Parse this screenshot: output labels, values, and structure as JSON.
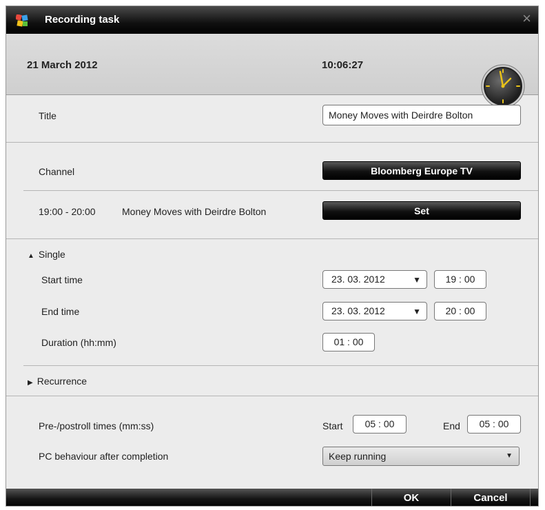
{
  "window": {
    "title": "Recording task",
    "close_glyph": "×"
  },
  "header": {
    "date": "21 March 2012",
    "time": "10:06:27",
    "clock_icon": "analog-clock-icon"
  },
  "form": {
    "title_label": "Title",
    "title_value": "Money Moves with Deirdre Bolton",
    "channel_label": "Channel",
    "channel_value": "Bloomberg Europe TV",
    "program_time": "19:00 - 20:00",
    "program_name": "Money Moves with Deirdre Bolton",
    "set_label": "Set"
  },
  "single": {
    "expander_label": "Single",
    "expanded": true,
    "start_label": "Start time",
    "start_date": "23. 03. 2012",
    "start_time": "19 : 00",
    "end_label": "End time",
    "end_date": "23. 03. 2012",
    "end_time": "20 : 00",
    "duration_label": "Duration (hh:mm)",
    "duration_value": "01 : 00"
  },
  "recurrence": {
    "expander_label": "Recurrence",
    "expanded": false
  },
  "options": {
    "preroll_label": "Pre-/postroll times (mm:ss)",
    "start_label": "Start",
    "start_value": "05 : 00",
    "end_label": "End",
    "end_value": "05 : 00",
    "pc_label": "PC behaviour after completion",
    "pc_value": "Keep running"
  },
  "footer": {
    "ok_label": "OK",
    "cancel_label": "Cancel"
  }
}
